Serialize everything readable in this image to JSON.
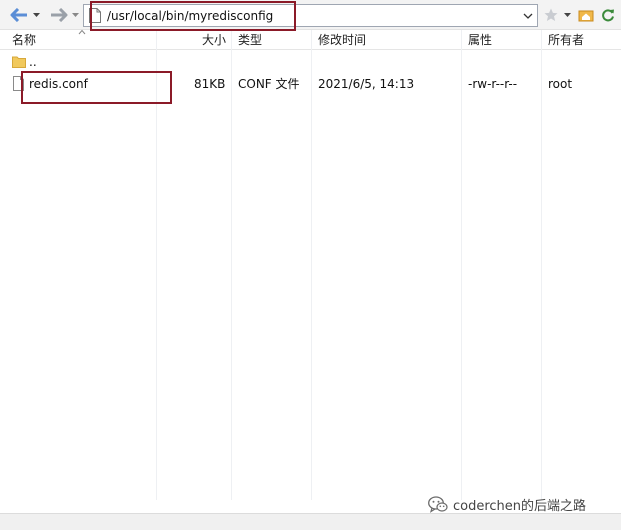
{
  "toolbar": {
    "address": "/usr/local/bin/myredisconfig",
    "icons": [
      "arrow-left-icon",
      "chevron-down-icon",
      "arrow-right-icon",
      "chevron-down-icon",
      "document-icon",
      "chevron-down-icon",
      "star-icon",
      "chevron-down-icon",
      "home-icon",
      "refresh-icon"
    ]
  },
  "columns": {
    "name": "名称",
    "size": "大小",
    "type": "类型",
    "modified": "修改时间",
    "attributes": "属性",
    "owner": "所有者"
  },
  "rows": [
    {
      "icon": "folder-icon",
      "name": "..",
      "size": "",
      "type": "",
      "modified": "",
      "attributes": "",
      "owner": ""
    },
    {
      "icon": "file-icon",
      "name": "redis.conf",
      "size": "81KB",
      "type": "CONF 文件",
      "modified": "2021/6/5, 14:13",
      "attributes": "-rw-r--r--",
      "owner": "root"
    }
  ],
  "watermark": {
    "text": "coderchen的后端之路"
  },
  "colors": {
    "annotation": "#8b1a28",
    "folder": "#f1c95d",
    "arrow_back": "#5b8ed6",
    "arrow_forward": "#9aa0a8"
  }
}
